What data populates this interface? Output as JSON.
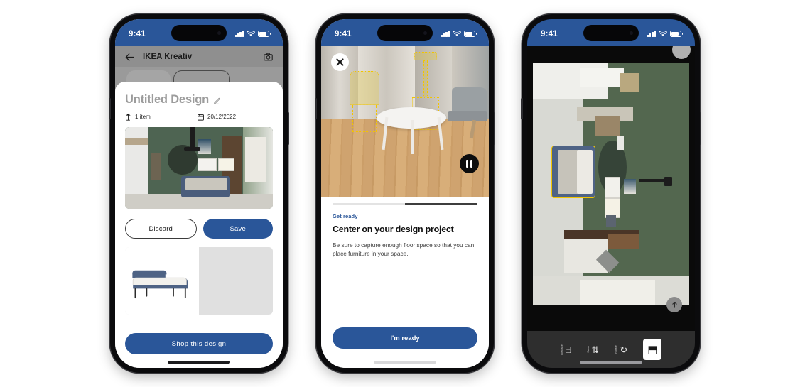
{
  "app": {
    "name": "IKEA Kreativ",
    "brand_blue": "#2a5699",
    "accent_yellow": "#f2c500"
  },
  "phone1": {
    "status": {
      "time": "9:41",
      "signal_icon": "cellular-signal-icon",
      "wifi_icon": "wifi-icon",
      "battery_icon": "battery-icon"
    },
    "header": {
      "back_icon": "back-arrow-icon",
      "title": "IKEA Kreativ",
      "camera_icon": "camera-icon"
    },
    "sheet": {
      "design_name": "Untitled Design",
      "edit_icon": "pencil-edit-icon",
      "meta": [
        {
          "icon": "lamp-icon",
          "label": "1 item"
        },
        {
          "icon": "calendar-icon",
          "label": "20/12/2022"
        }
      ],
      "room_preview_name": "green-bedroom-render",
      "discard_label": "Discard",
      "save_label": "Save",
      "product_name": "blue-daybed-product-image",
      "shop_label": "Shop this design"
    }
  },
  "phone2": {
    "status": {
      "time": "9:41"
    },
    "camera": {
      "close_icon": "close-x-icon",
      "pause_icon": "pause-icon",
      "scene_name": "living-room-ar-scan"
    },
    "sheet": {
      "progress": {
        "steps": 2,
        "active_index": 1
      },
      "eyebrow": "Get ready",
      "heading": "Center on your design project",
      "body": "Be sure to capture enough floor space so that you can place furniture in your space.",
      "cta_label": "I'm ready"
    }
  },
  "phone3": {
    "status": {
      "time": "9:41"
    },
    "ar": {
      "scene_name": "rotated-bedroom-ar-view",
      "selected_item": "blue-daybed-highlight"
    },
    "fab_icon": "info-icon",
    "toolbar": [
      {
        "icon": "replace-icon",
        "glyph": "⌸",
        "label": "Replace",
        "active": false
      },
      {
        "icon": "swap-icon",
        "glyph": "⇅",
        "label": "Swap",
        "active": false
      },
      {
        "icon": "rotate-icon",
        "glyph": "↻",
        "label": "Rotate",
        "active": false
      },
      {
        "icon": "move-icon",
        "glyph": "⬒",
        "label": "Move",
        "active": true
      }
    ]
  }
}
